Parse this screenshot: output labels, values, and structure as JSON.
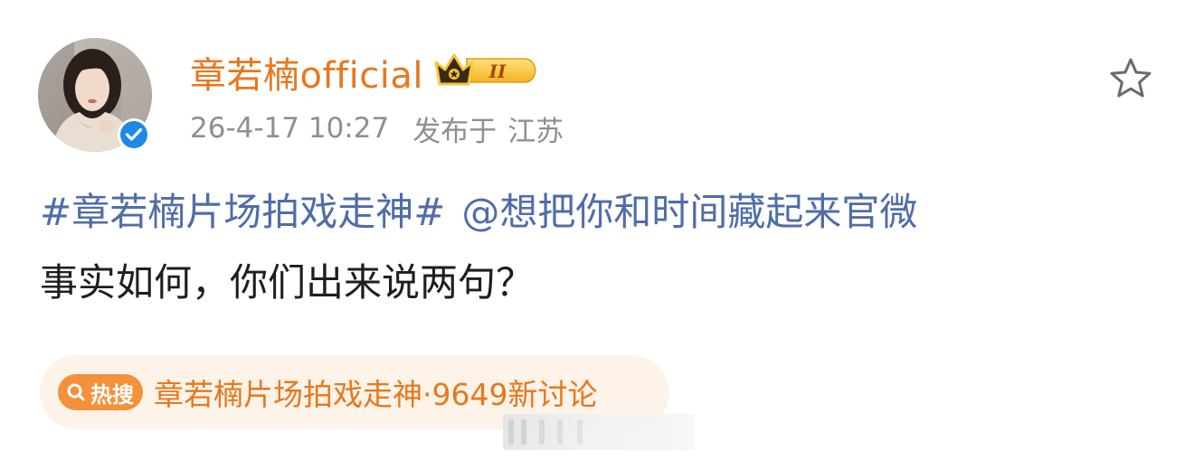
{
  "post": {
    "username": "章若楠official",
    "vip_level": "II",
    "timestamp": "26-4-17 10:27",
    "location_prefix": "发布于",
    "location": "江苏",
    "topic": "#章若楠片场拍戏走神#",
    "mention": "@想把你和时间藏起来官微",
    "body_text": "事实如何，你们出来说两句？"
  },
  "hot_search": {
    "tag_label": "热搜",
    "title": "章若楠片场拍戏走神",
    "count_text": "·9649新讨论"
  },
  "icons": {
    "verified": "verified-check-icon",
    "vip": "crown-badge-icon",
    "star": "star-outline-icon",
    "search": "search-icon"
  },
  "colors": {
    "username": "#e8771d",
    "link": "#4f6da8",
    "verified": "#1d8ae6",
    "hot_bg": "#fdf3e8",
    "hot_tag": "#f5903b"
  }
}
